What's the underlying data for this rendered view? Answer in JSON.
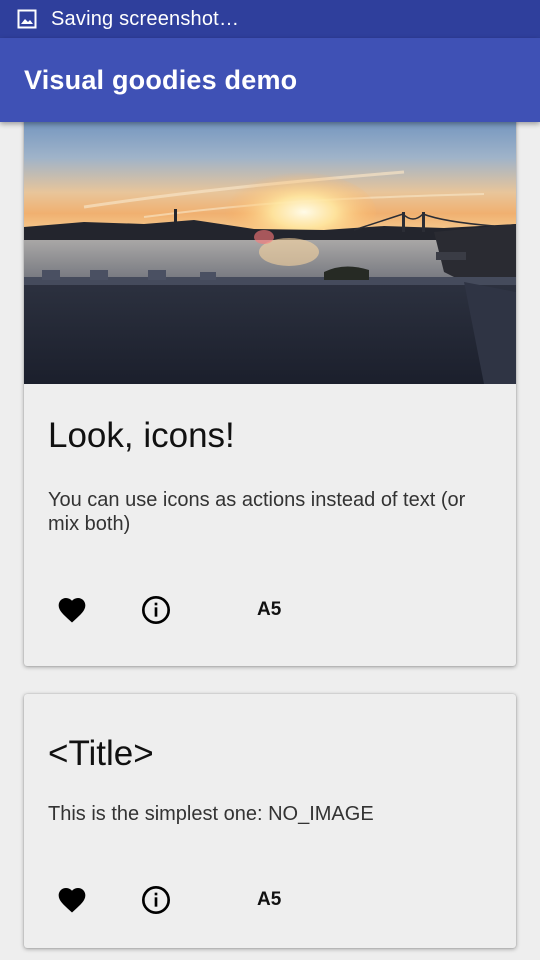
{
  "status_bar": {
    "text": "Saving screenshot…",
    "icon": "image-icon"
  },
  "app_bar": {
    "title": "Visual goodies demo",
    "color": "#3f51b5"
  },
  "cards": [
    {
      "image": "sunset-photo",
      "title": "Look, icons!",
      "text": "You can use icons as actions instead of text (or mix both)",
      "actions": {
        "icon1": "heart-icon",
        "icon2": "info-icon",
        "text_action": "A5"
      }
    },
    {
      "title": "<Title>",
      "text": "This is the simplest one: NO_IMAGE",
      "actions": {
        "icon1": "heart-icon",
        "icon2": "info-icon",
        "text_action": "A5"
      }
    }
  ]
}
